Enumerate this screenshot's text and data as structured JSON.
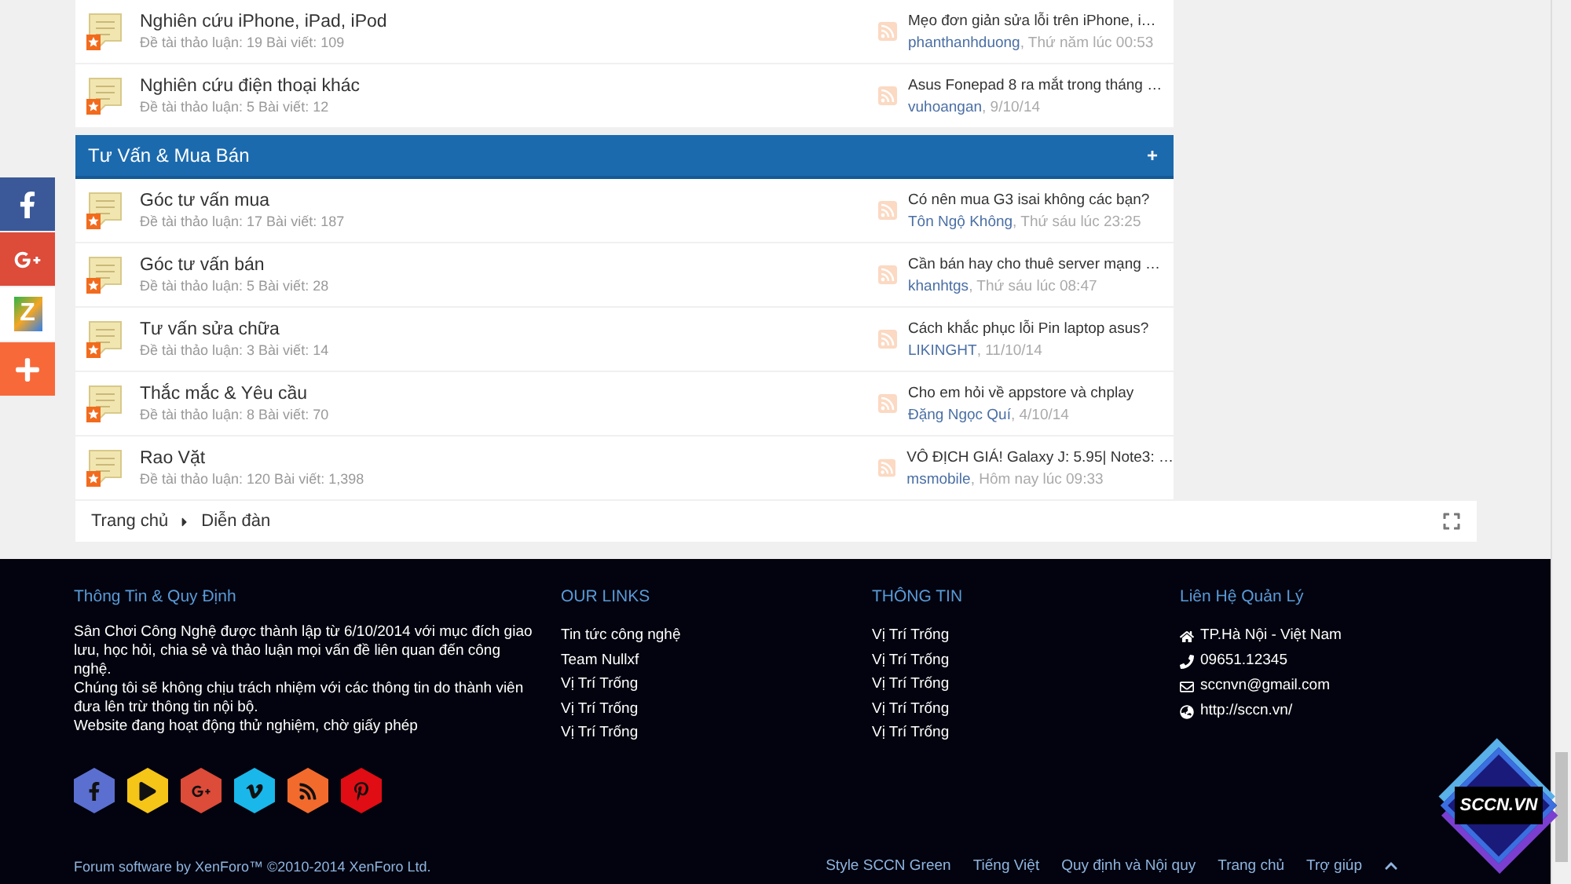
{
  "share_buttons": [
    {
      "kind": "facebook"
    },
    {
      "kind": "googleplus"
    },
    {
      "kind": "zing",
      "label": "Z"
    },
    {
      "kind": "more"
    }
  ],
  "top_forums": [
    {
      "title": "Nghiên cứu iPhone, iPad, iPod",
      "stats": "Đề tài thảo luận: 19 Bài viết: 109",
      "last_post": {
        "title": "Mẹo đơn giản sửa lỗi trên iPhone, i…",
        "user": "phanthanhduong",
        "date": ", Thứ năm lúc 00:53"
      }
    },
    {
      "title": "Nghiên cứu điện thoại khác",
      "stats": "Đề tài thảo luận: 5 Bài viết: 12",
      "last_post": {
        "title": "Asus Fonepad 8 ra mắt trong tháng …",
        "user": "vuhoangan",
        "date": ", 9/10/14"
      }
    }
  ],
  "section": {
    "title": "Tư Vấn & Mua Bán",
    "toggle": "+",
    "forums": [
      {
        "title": "Góc tư vấn mua",
        "stats": "Đề tài thảo luận: 17 Bài viết: 187",
        "last_post": {
          "title": "Có nên mua G3 isai không các bạn?",
          "user": "Tôn Ngộ Không",
          "date": ", Thứ sáu lúc 23:25"
        }
      },
      {
        "title": "Góc tư vấn bán",
        "stats": "Đề tài thảo luận: 5 Bài viết: 28",
        "last_post": {
          "title": "Cần bán hay cho thuê server mạng …",
          "user": "khanhtgs",
          "date": ", Thứ sáu lúc 08:47"
        }
      },
      {
        "title": "Tư vấn sửa chữa",
        "stats": "Đề tài thảo luận: 3 Bài viết: 14",
        "last_post": {
          "title": "Cách khắc phục lỗi Pin laptop asus?",
          "user": "LIKINGHT",
          "date": ", 11/10/14"
        }
      },
      {
        "title": "Thắc mắc & Yêu cầu",
        "stats": "Đề tài thảo luận: 8 Bài viết: 70",
        "last_post": {
          "title": "Cho em hỏi về appstore và chplay",
          "user": "Đặng Ngọc Quí",
          "date": ", 4/10/14"
        }
      },
      {
        "title": "Rao Vặt",
        "stats": "Đề tài thảo luận: 120 Bài viết: 1,398",
        "last_post": {
          "title": "VÔ ĐỊCH GIÁ! Galaxy J: 5.95| Note3: …",
          "user": "msmobile",
          "date": ", Hôm nay lúc 09:33"
        }
      }
    ]
  },
  "breadcrumb": [
    "Trang chủ",
    "Diễn đàn"
  ],
  "footer": {
    "about": {
      "title": "Thông Tin & Quy Định",
      "paragraphs": [
        "Sân Chơi Công Nghệ được thành lập từ 6/10/2014 với mục đích giao lưu, học hỏi, chia sẻ và thảo luận mọi vấn đề liên quan đến công nghệ.",
        "Chúng tôi sẽ không chịu trách nhiệm với các thông tin do thành viên đưa lên trừ thông tin nội bộ.",
        "Website đang hoạt động thử nghiệm, chờ giấy phép"
      ]
    },
    "socials": [
      {
        "kind": "facebook",
        "color": "#5b6fd0"
      },
      {
        "kind": "youtube",
        "color": "#f5c518"
      },
      {
        "kind": "googleplus",
        "color": "#dd4b39"
      },
      {
        "kind": "vimeo",
        "color": "#1ab7ea"
      },
      {
        "kind": "rss",
        "color": "#f26b2d"
      },
      {
        "kind": "pinterest",
        "color": "#e00d14"
      }
    ],
    "links": {
      "title": "OUR LINKS",
      "items": [
        "Tin tức công nghệ",
        "Team Nullxf",
        "Vị Trí Trống",
        "Vị Trí Trống",
        "Vị Trí Trống"
      ]
    },
    "info": {
      "title": "THÔNG TIN",
      "items": [
        "Vị Trí Trống",
        "Vị Trí Trống",
        "Vị Trí Trống",
        "Vị Trí Trống",
        "Vị Trí Trống"
      ]
    },
    "contact": {
      "title": "Liên Hệ Quản Lý",
      "items": [
        {
          "kind": "address",
          "text": "TP.Hà Nội - Việt Nam"
        },
        {
          "kind": "phone",
          "text": "09651.12345"
        },
        {
          "kind": "email",
          "text": "sccnvn@gmail.com"
        },
        {
          "kind": "website",
          "text": "http://sccn.vn/"
        }
      ]
    },
    "copyright": "Forum software by XenForo™ ©2010-2014 XenForo Ltd.",
    "bottom_links": [
      "Style SCCN Green",
      "Tiếng Việt",
      "Quy định và Nội quy",
      "Trang chủ",
      "Trợ giúp"
    ]
  },
  "logo": {
    "text": "SCCN.VN"
  }
}
